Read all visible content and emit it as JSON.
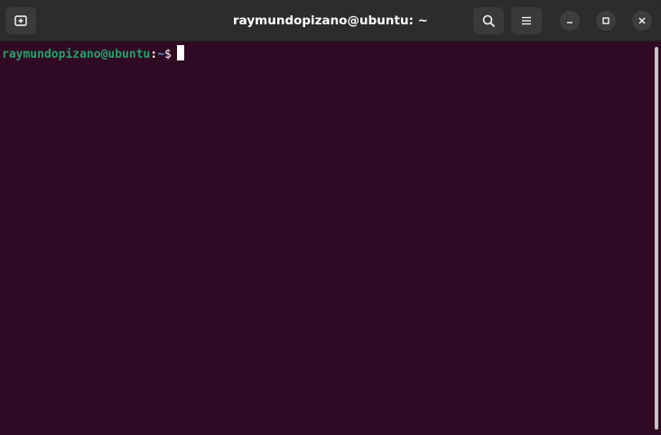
{
  "window": {
    "title": "raymundopizano@ubuntu: ~"
  },
  "titlebar": {
    "icons": {
      "new_tab": "new-tab-icon",
      "search": "search-icon",
      "menu": "hamburger-menu-icon",
      "minimize": "minimize-icon",
      "maximize": "maximize-icon",
      "close": "close-icon"
    }
  },
  "terminal": {
    "prompt_user_host": "raymundopizano@ubuntu",
    "prompt_colon": ":",
    "prompt_path": "~",
    "prompt_symbol": "$",
    "colors": {
      "background": "#300a24",
      "user_host": "#26a269",
      "path": "#5a8fd6",
      "text": "#ffffff"
    }
  }
}
